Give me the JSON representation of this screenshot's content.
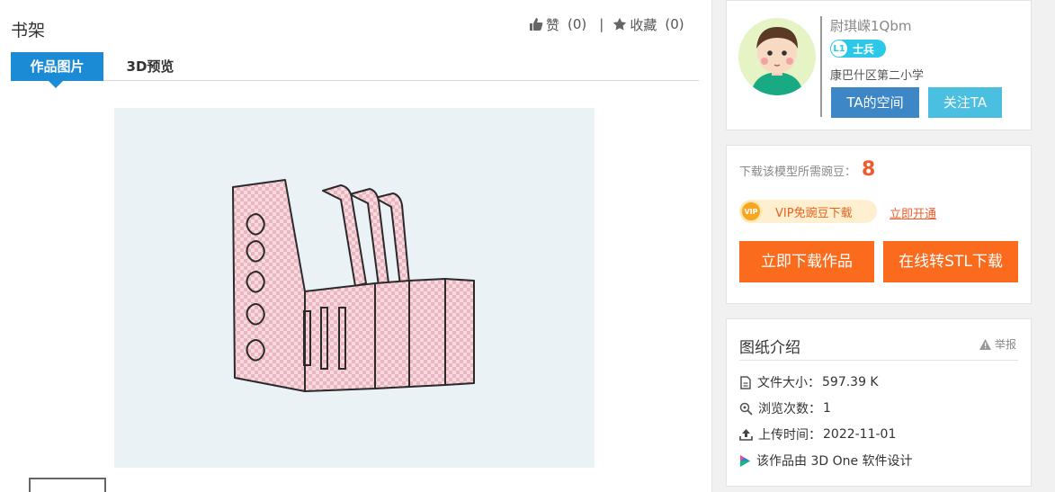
{
  "title": "书架",
  "actions": {
    "like_label": "赞",
    "like_count": "(0)",
    "separator": "|",
    "fav_label": "收藏",
    "fav_count": "(0)"
  },
  "tabs": [
    {
      "label": "作品图片",
      "active": true
    },
    {
      "label": "3D预览",
      "active": false
    }
  ],
  "user": {
    "name": "尉琪嵘1Qbm",
    "level": "L1",
    "rank": "士兵",
    "school": "康巴什区第二小学",
    "space_button": "TA的空间",
    "follow_button": "关注TA"
  },
  "download": {
    "need_label": "下载该模型所需豌豆：",
    "need_value": "8",
    "vip_icon": "VIP",
    "vip_text": "VIP免豌豆下载",
    "open_link": "立即开通",
    "download_button": "立即下载作品",
    "stl_button": "在线转STL下载"
  },
  "intro": {
    "title": "图纸介绍",
    "report": "举报",
    "file_size_label": "文件大小：",
    "file_size": "597.39 K",
    "views_label": "浏览次数：",
    "views": "1",
    "upload_label": "上传时间：",
    "upload_date": "2022-11-01",
    "designed_with": "该作品由 3D One 软件设计"
  },
  "colors": {
    "tab_active": "#1b8bd6",
    "download": "#fb6b1e",
    "space_btn": "#3d87c7",
    "follow_btn": "#4bbfe0",
    "price": "#ef5b2a"
  }
}
